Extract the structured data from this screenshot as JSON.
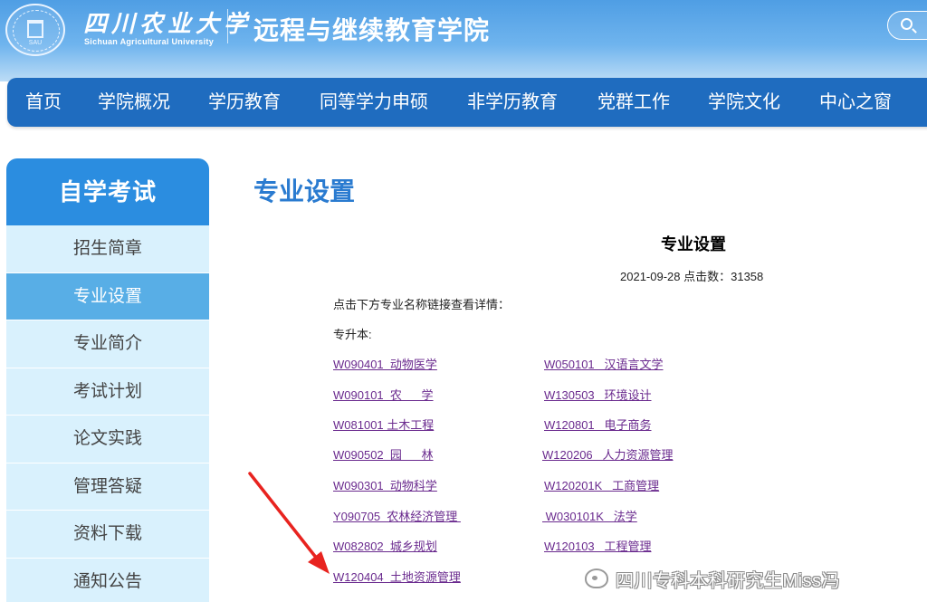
{
  "header": {
    "seal_abbr": "SAU",
    "university_cn": "四川农业大学",
    "university_en": "Sichuan Agricultural University",
    "college_title": "远程与继续教育学院"
  },
  "nav": {
    "items": [
      {
        "label": "首页"
      },
      {
        "label": "学院概况"
      },
      {
        "label": "学历教育"
      },
      {
        "label": "同等学力申硕"
      },
      {
        "label": "非学历教育"
      },
      {
        "label": "党群工作"
      },
      {
        "label": "学院文化"
      },
      {
        "label": "中心之窗"
      }
    ]
  },
  "sidebar": {
    "title": "自学考试",
    "items": [
      {
        "label": "招生简章"
      },
      {
        "label": "专业设置"
      },
      {
        "label": "专业简介"
      },
      {
        "label": "考试计划"
      },
      {
        "label": "论文实践"
      },
      {
        "label": "管理答疑"
      },
      {
        "label": "资料下载"
      },
      {
        "label": "通知公告"
      }
    ],
    "active_index": 1
  },
  "main": {
    "page_title": "专业设置",
    "article_title": "专业设置",
    "article_meta": "2021-09-28 点击数：31358",
    "intro": "点击下方专业名称链接查看详情：",
    "section_label": "专升本:",
    "majors_left": [
      "W090401  动物医学",
      "W090101  农      学",
      "W081001 土木工程",
      "W090502  园      林",
      "W090301  动物科学",
      "Y090705  农林经济管理 ",
      "W082802  城乡规划",
      "W120404  土地资源管理"
    ],
    "majors_right": [
      "W050101   汉语言文学",
      "W130503   环境设计",
      "W120801   电子商务",
      "W120206   人力资源管理",
      "W120201K   工商管理",
      " W030101K   法学",
      "W120103   工程管理"
    ]
  },
  "watermark": {
    "text": "四川专科本科研究生Miss冯"
  },
  "colors": {
    "nav_bg": "#1f6cbf",
    "sidebar_title_bg": "#2b8de0",
    "sidebar_item_bg": "#d9f1fd",
    "sidebar_active_bg": "#58aee6",
    "link": "#6a2a8e",
    "page_title": "#2a7bd0",
    "annotation_arrow": "#e8231f"
  }
}
